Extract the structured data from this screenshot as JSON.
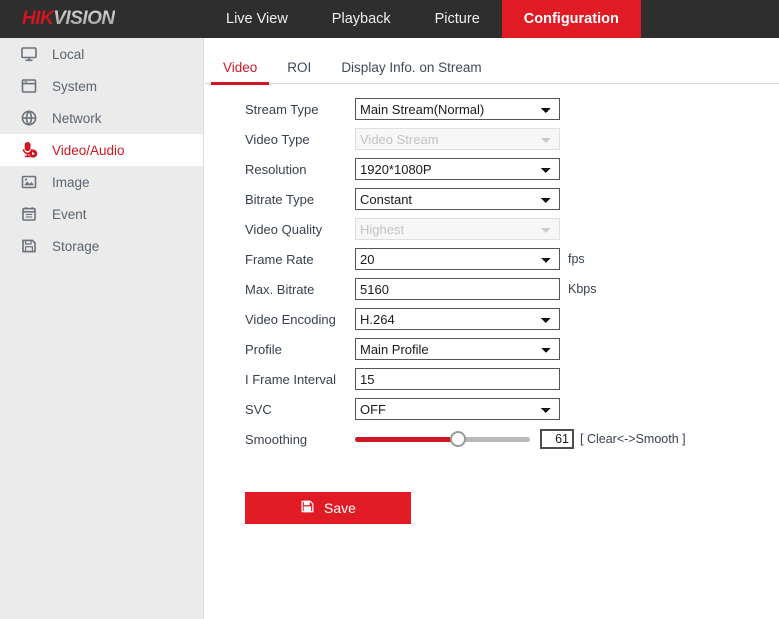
{
  "brand": {
    "part1": "HIK",
    "part2": "VISION"
  },
  "nav": {
    "tabs": [
      {
        "label": "Live View",
        "active": false
      },
      {
        "label": "Playback",
        "active": false
      },
      {
        "label": "Picture",
        "active": false
      },
      {
        "label": "Configuration",
        "active": true
      }
    ]
  },
  "sidebar": {
    "items": [
      {
        "label": "Local",
        "icon": "monitor-icon",
        "active": false
      },
      {
        "label": "System",
        "icon": "window-icon",
        "active": false
      },
      {
        "label": "Network",
        "icon": "globe-icon",
        "active": false
      },
      {
        "label": "Video/Audio",
        "icon": "microphone-icon",
        "active": true
      },
      {
        "label": "Image",
        "icon": "picture-icon",
        "active": false
      },
      {
        "label": "Event",
        "icon": "calendar-icon",
        "active": false
      },
      {
        "label": "Storage",
        "icon": "save-disk-icon",
        "active": false
      }
    ]
  },
  "subtabs": [
    {
      "label": "Video",
      "active": true
    },
    {
      "label": "ROI",
      "active": false
    },
    {
      "label": "Display Info. on Stream",
      "active": false
    }
  ],
  "form": {
    "stream_type": {
      "label": "Stream Type",
      "value": "Main Stream(Normal)",
      "disabled": false
    },
    "video_type": {
      "label": "Video Type",
      "value": "Video Stream",
      "disabled": true
    },
    "resolution": {
      "label": "Resolution",
      "value": "1920*1080P",
      "disabled": false
    },
    "bitrate_type": {
      "label": "Bitrate Type",
      "value": "Constant",
      "disabled": false
    },
    "video_quality": {
      "label": "Video Quality",
      "value": "Highest",
      "disabled": true
    },
    "frame_rate": {
      "label": "Frame Rate",
      "value": "20",
      "unit": "fps",
      "disabled": false
    },
    "max_bitrate": {
      "label": "Max. Bitrate",
      "value": "5160",
      "unit": "Kbps",
      "disabled": false
    },
    "video_encoding": {
      "label": "Video Encoding",
      "value": "H.264",
      "disabled": false
    },
    "profile": {
      "label": "Profile",
      "value": "Main Profile",
      "disabled": false
    },
    "i_frame": {
      "label": "I Frame Interval",
      "value": "15",
      "disabled": false
    },
    "svc": {
      "label": "SVC",
      "value": "OFF",
      "disabled": false
    },
    "smoothing": {
      "label": "Smoothing",
      "value": "61",
      "percent": 59,
      "hint": "[ Clear<->Smooth ]"
    }
  },
  "save": {
    "label": "Save",
    "icon": "floppy-disk-icon"
  },
  "colors": {
    "accent": "#cf1622",
    "accent_bright": "#e01b24",
    "header_bg": "#2e2e2e",
    "sidebar_bg": "#ebebeb"
  }
}
